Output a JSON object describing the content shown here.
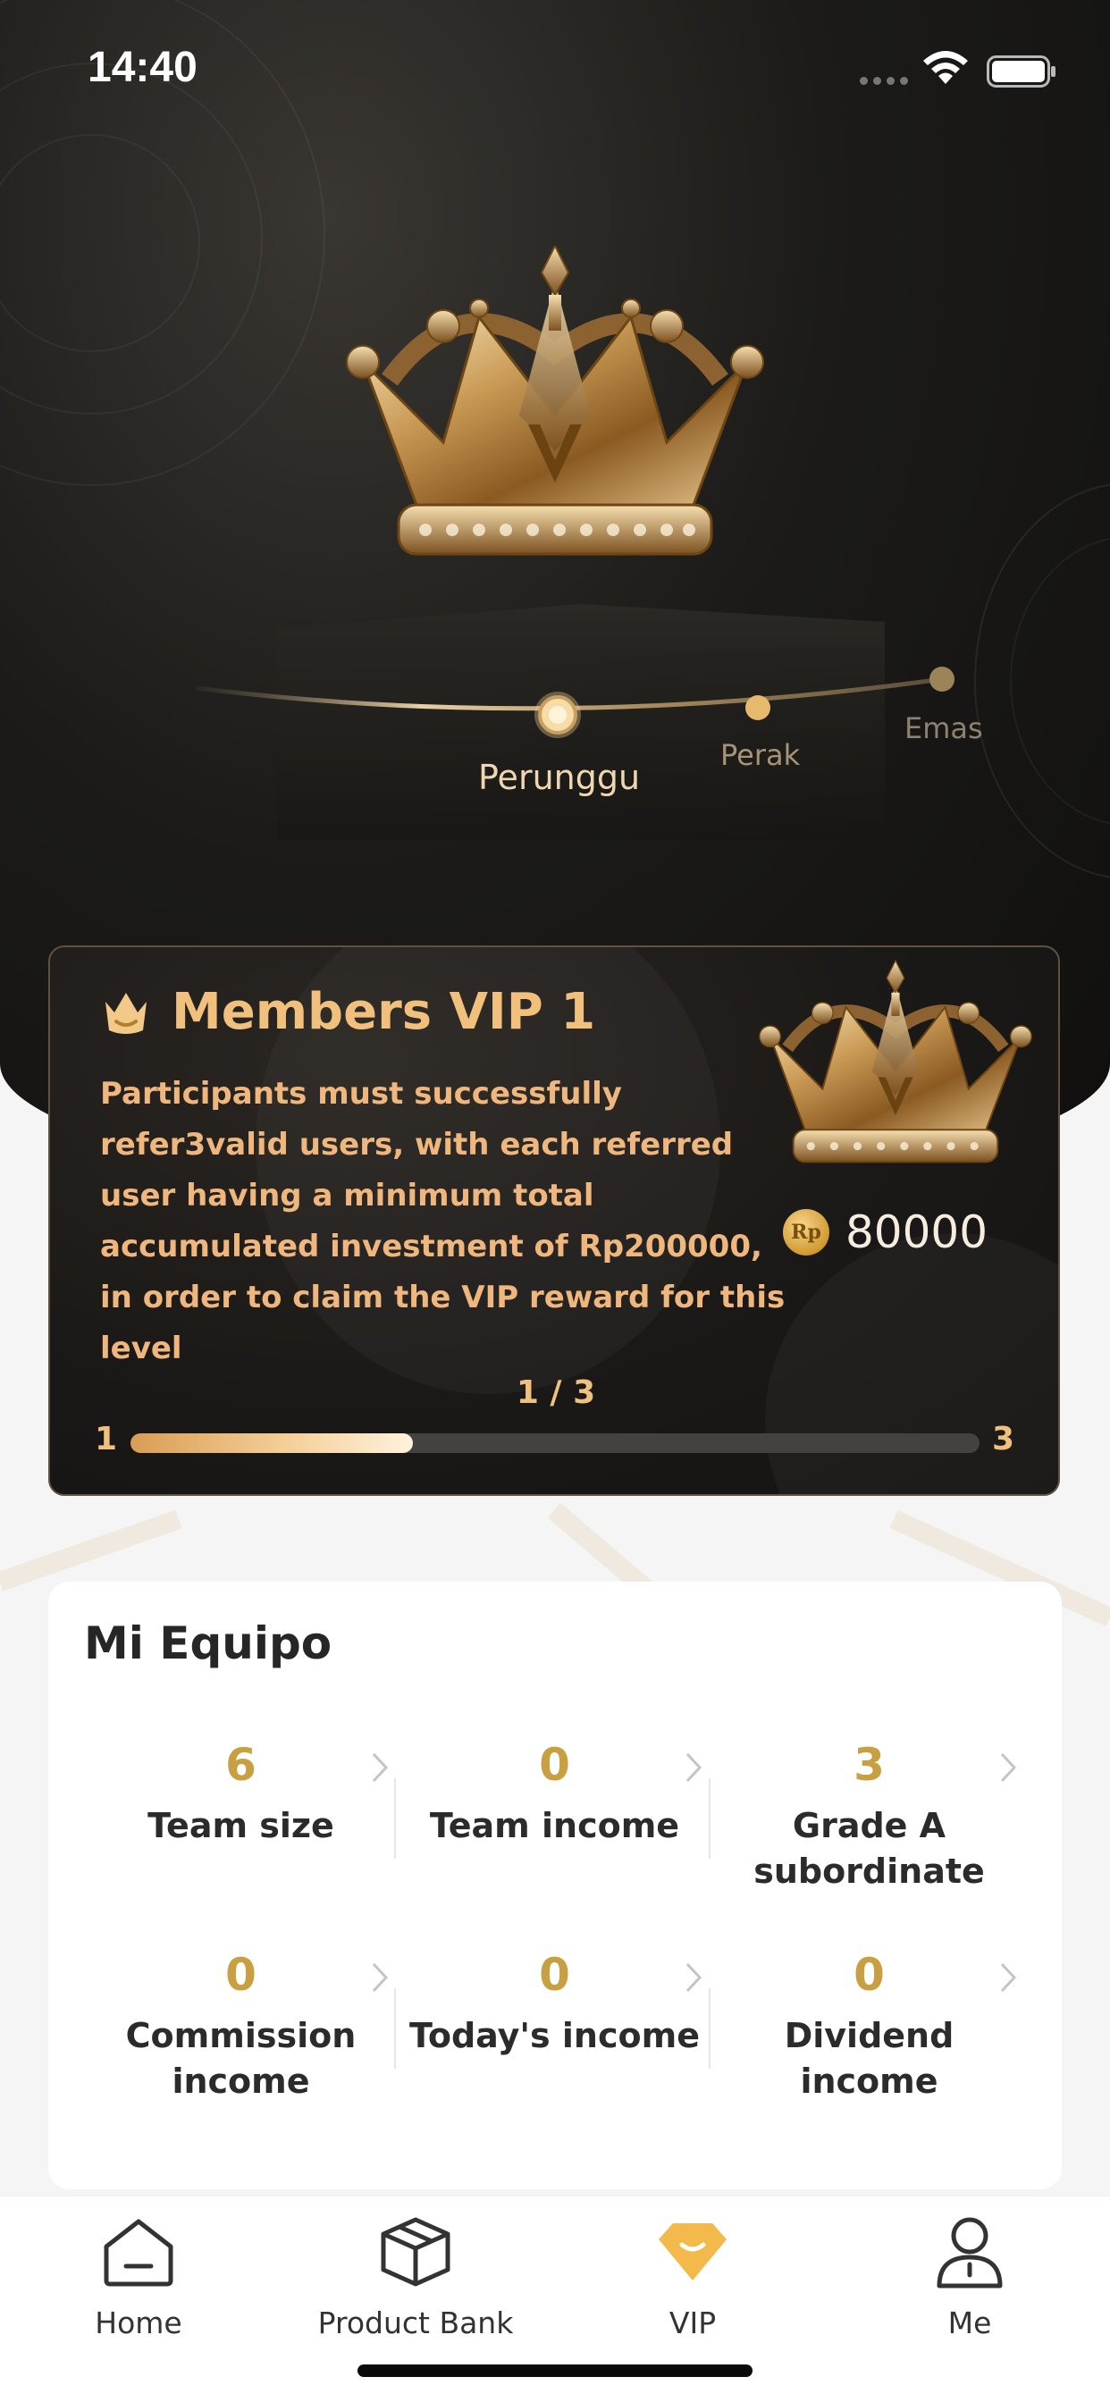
{
  "status_bar": {
    "time": "14:40"
  },
  "hero": {
    "levels": [
      {
        "label": "Perunggu",
        "current": true
      },
      {
        "label": "Perak",
        "current": false
      },
      {
        "label": "Emas",
        "current": false
      }
    ]
  },
  "vip_card": {
    "title": "Members VIP 1",
    "description": "Participants must successfully refer3valid users, with each referred user having a minimum total accumulated investment of Rp200000, in order to claim the VIP reward for this level",
    "reward_currency": "Rp",
    "reward_amount": "80000",
    "progress_text": "1 / 3",
    "progress_min": "1",
    "progress_max": "3",
    "progress_fraction": 0.333
  },
  "team": {
    "title": "Mi Equipo",
    "stats": [
      {
        "value": "6",
        "label": "Team size"
      },
      {
        "value": "0",
        "label": "Team income"
      },
      {
        "value": "3",
        "label": "Grade A subordinate"
      },
      {
        "value": "0",
        "label": "Commission income"
      },
      {
        "value": "0",
        "label": "Today's income"
      },
      {
        "value": "0",
        "label": "Dividend income"
      }
    ]
  },
  "tab_bar": {
    "items": [
      {
        "label": "Home",
        "icon": "home-icon"
      },
      {
        "label": "Product Bank",
        "icon": "box-icon"
      },
      {
        "label": "VIP",
        "icon": "vip-diamond-icon",
        "active": true
      },
      {
        "label": "Me",
        "icon": "user-icon"
      }
    ]
  },
  "colors": {
    "accent_gold": "#c9a041",
    "vip_text": "#efb77d",
    "hero_dark": "#121110"
  }
}
